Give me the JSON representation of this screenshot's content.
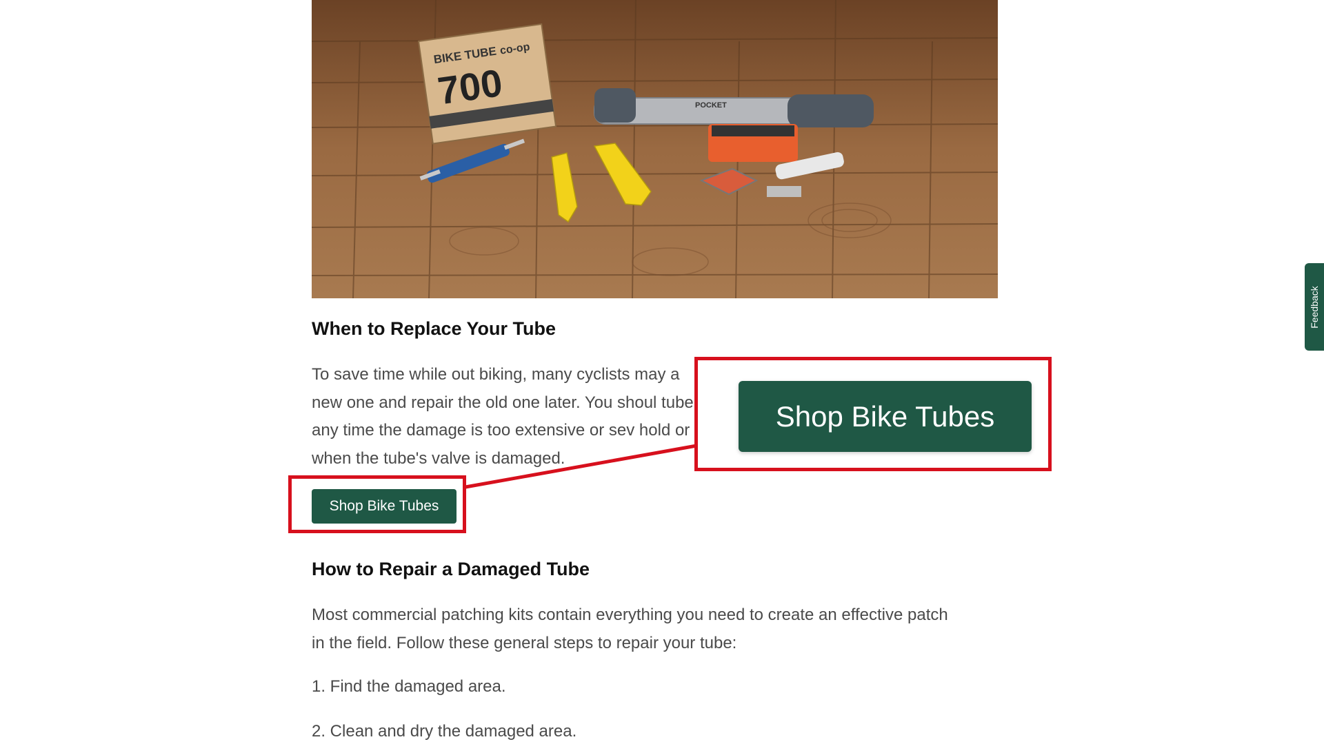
{
  "article": {
    "hero_image_alt": "Bike tube box, multitool, tire levers, pump and patch kit on wooden floor",
    "product_box": {
      "line1": "BIKE TUBE",
      "line2": "700",
      "brand": "co-op"
    },
    "pump_label": "POCKET",
    "section1": {
      "heading": "When to Replace Your Tube",
      "body": "To save time while out biking, many cyclists may a new one and repair the old one later. You shoul tube any time the damage is too extensive or sev hold or when the tube's valve is damaged.",
      "button_label": "Shop Bike Tubes"
    },
    "section2": {
      "heading": "How to Repair a Damaged Tube",
      "body": "Most commercial patching kits contain everything you need to create an effective patch in the field. Follow these general steps to repair your tube:",
      "steps": [
        "1. Find the damaged area.",
        "2. Clean and dry the damaged area."
      ]
    }
  },
  "callout": {
    "button_label": "Shop Bike Tubes",
    "highlight_color": "#d7101d"
  },
  "feedback": {
    "label": "Feedback"
  },
  "colors": {
    "brand_green": "#1f5845",
    "highlight_red": "#d7101d"
  }
}
